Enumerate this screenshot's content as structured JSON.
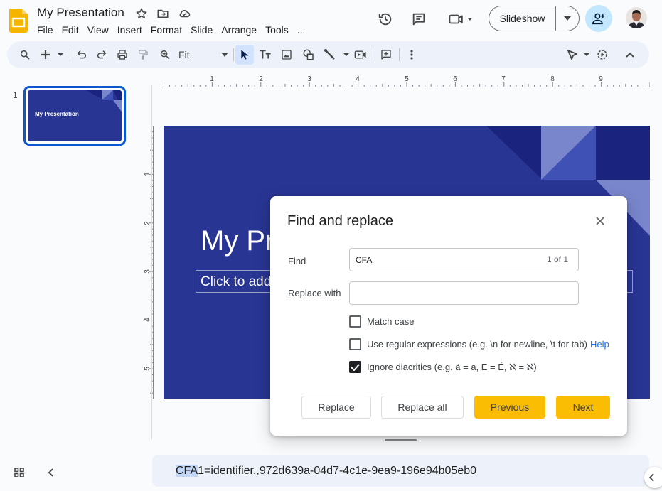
{
  "header": {
    "title": "My Presentation",
    "menus": [
      "File",
      "Edit",
      "View",
      "Insert",
      "Format",
      "Slide",
      "Arrange",
      "Tools",
      "..."
    ],
    "slideshow_label": "Slideshow"
  },
  "toolbar": {
    "zoom_label": "Fit",
    "icons": [
      "search-icon",
      "add-icon",
      "undo-icon",
      "redo-icon",
      "print-icon",
      "paint-format-icon",
      "zoom-icon",
      "select-icon",
      "textbox-icon",
      "image-icon",
      "shape-icon",
      "line-icon",
      "video-icon",
      "comment-icon",
      "more-icon",
      "pointer-icon",
      "motion-icon",
      "collapse-icon"
    ]
  },
  "filmstrip": {
    "slide_number": "1",
    "thumb_title": "My Presentation"
  },
  "ruler": {
    "h_labels": [
      "1",
      "2",
      "3",
      "4",
      "5",
      "6",
      "7",
      "8",
      "9"
    ],
    "v_labels": [
      "1",
      "2",
      "3",
      "4",
      "5"
    ]
  },
  "slide": {
    "title": "My Presentation",
    "subtitle": "Click to add subtitle"
  },
  "dialog": {
    "title": "Find and replace",
    "find_label": "Find",
    "find_value": "CFA",
    "match_count": "1 of 1",
    "replace_label": "Replace with",
    "replace_value": "",
    "match_case_label": "Match case",
    "match_case_checked": false,
    "regex_label": "Use regular expressions (e.g. \\n for newline, \\t for tab)",
    "regex_checked": false,
    "help_label": "Help",
    "diacritics_label": "Ignore diacritics (e.g. ä = a, E = É, ℵ = ℵ)",
    "diacritics_checked": true,
    "replace_button": "Replace",
    "replace_all_button": "Replace all",
    "previous_button": "Previous",
    "next_button": "Next"
  },
  "notes": {
    "highlight": "CFA",
    "rest": "1=identifier,,972d639a-04d7-4c1e-9ea9-196e94b05eb0"
  },
  "colors": {
    "slide_bg": "#283593",
    "accent_blue": "#0b57d0",
    "button_yellow": "#fbbc04",
    "share_bg": "#c2e7ff"
  }
}
